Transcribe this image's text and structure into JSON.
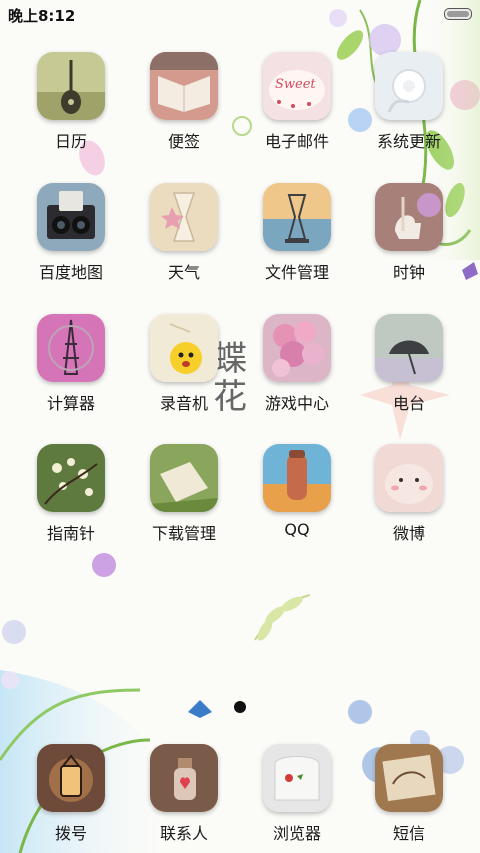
{
  "status_bar": {
    "time": "晚上8:12"
  },
  "wallpaper": {
    "calligraphy_chars": [
      "蝶",
      "花"
    ]
  },
  "grid_rows": [
    [
      {
        "label": "日历",
        "icon": "guitar-photo-icon"
      },
      {
        "label": "便签",
        "icon": "open-book-photo-icon"
      },
      {
        "label": "电子邮件",
        "icon": "sweet-cake-photo-icon"
      },
      {
        "label": "系统更新",
        "icon": "earphones-photo-icon"
      }
    ],
    [
      {
        "label": "百度地图",
        "icon": "vintage-camera-photo-icon"
      },
      {
        "label": "天气",
        "icon": "hourglass-star-photo-icon"
      },
      {
        "label": "文件管理",
        "icon": "hourglass-sunset-photo-icon"
      },
      {
        "label": "时钟",
        "icon": "carousel-horse-photo-icon"
      }
    ],
    [
      {
        "label": "计算器",
        "icon": "eiffel-tower-photo-icon"
      },
      {
        "label": "录音机",
        "icon": "smiley-photo-icon"
      },
      {
        "label": "游戏中心",
        "icon": "balloons-photo-icon"
      },
      {
        "label": "电台",
        "icon": "umbrella-photo-icon"
      }
    ],
    [
      {
        "label": "指南针",
        "icon": "blossom-photo-icon"
      },
      {
        "label": "下载管理",
        "icon": "notebook-grass-photo-icon"
      },
      {
        "label": "QQ",
        "icon": "flask-photo-icon"
      },
      {
        "label": "微博",
        "icon": "cute-face-photo-icon"
      }
    ]
  ],
  "dock": [
    {
      "label": "拨号",
      "icon": "lantern-photo-icon"
    },
    {
      "label": "联系人",
      "icon": "heart-bottle-photo-icon"
    },
    {
      "label": "浏览器",
      "icon": "strawberry-card-photo-icon"
    },
    {
      "label": "短信",
      "icon": "sketchbook-photo-icon"
    }
  ],
  "page_indicator": {
    "current": 1,
    "total": 1
  }
}
